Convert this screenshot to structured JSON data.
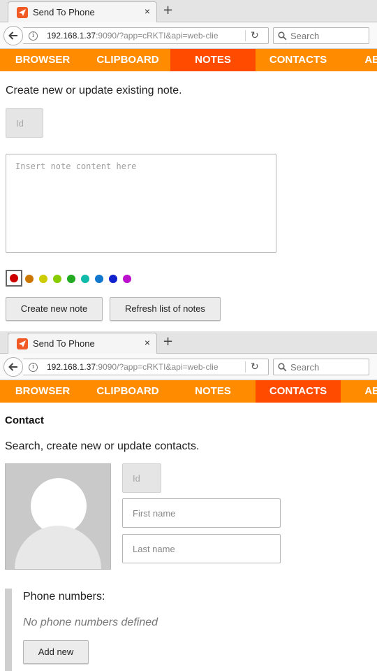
{
  "browser": {
    "tab_title": "Send To Phone",
    "tab_close": "×",
    "new_tab": "+",
    "url_host": "192.168.1.37",
    "url_rest": ":9090/?app=cRKTI&api=web-clie",
    "reload": "↻",
    "search_placeholder": "Search"
  },
  "menu": {
    "items": [
      "BROWSER",
      "CLIPBOARD",
      "NOTES",
      "CONTACTS",
      "ABOUT"
    ]
  },
  "notes_page": {
    "active_menu": "NOTES",
    "intro": "Create new or update existing note.",
    "id_placeholder": "Id",
    "content_placeholder": "Insert note content here",
    "colors": [
      "#cc0000",
      "#cc7700",
      "#cccc00",
      "#88cc00",
      "#22aa22",
      "#11bbaa",
      "#1177cc",
      "#1122cc",
      "#bb11cc"
    ],
    "selected_color_index": 0,
    "create_button": "Create new note",
    "refresh_button": "Refresh list of notes"
  },
  "contacts_page": {
    "active_menu": "CONTACTS",
    "heading": "Contact",
    "intro": "Search, create new or update contacts.",
    "id_placeholder": "Id",
    "first_name_placeholder": "First name",
    "last_name_placeholder": "Last name",
    "phone_label": "Phone numbers:",
    "phone_empty": "No phone numbers defined",
    "add_button": "Add new"
  },
  "colors": {
    "menu_bg": "#ff8c00",
    "menu_active_bg": "#ff4b00"
  }
}
